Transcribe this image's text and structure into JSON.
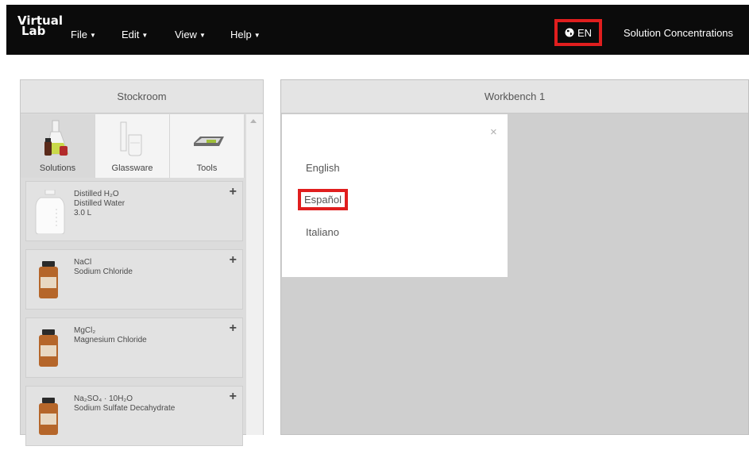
{
  "app": {
    "logo_line1": "Virtual",
    "logo_line2": "Lab",
    "title": "Solution Concentrations"
  },
  "menu": {
    "file": "File",
    "edit": "Edit",
    "view": "View",
    "help": "Help"
  },
  "language_button": {
    "label": "EN",
    "icon": "globe-icon"
  },
  "stockroom": {
    "title": "Stockroom",
    "tabs": [
      {
        "label": "Solutions",
        "icon": "solutions-icon"
      },
      {
        "label": "Glassware",
        "icon": "glassware-icon"
      },
      {
        "label": "Tools",
        "icon": "scale-icon"
      }
    ],
    "items": [
      {
        "formula": "Distilled H₂O",
        "name": "Distilled Water",
        "amount": "3.0 L",
        "icon": "water-jug-icon"
      },
      {
        "formula": "NaCl",
        "name": "Sodium Chloride",
        "amount": "",
        "icon": "reagent-bottle-icon"
      },
      {
        "formula": "MgCl₂",
        "name": "Magnesium Chloride",
        "amount": "",
        "icon": "reagent-bottle-icon"
      },
      {
        "formula": "Na₂SO₄ · 10H₂O",
        "name": "Sodium Sulfate Decahydrate",
        "amount": "",
        "icon": "reagent-bottle-icon"
      }
    ],
    "add_symbol": "+"
  },
  "workbench": {
    "title": "Workbench 1",
    "language_menu": {
      "close": "×",
      "options": [
        "English",
        "Español",
        "Italiano"
      ],
      "highlighted": "Español"
    }
  },
  "colors": {
    "navbar": "#0b0b0b",
    "highlight": "#e01e1e",
    "panel": "#dcdcdc",
    "workbench": "#cfcfcf"
  }
}
